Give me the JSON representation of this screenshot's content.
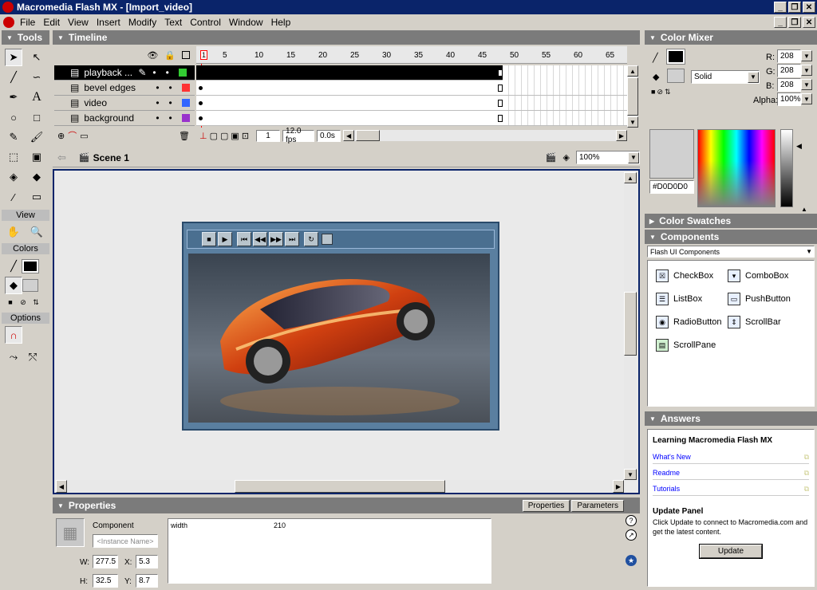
{
  "window": {
    "title": "Macromedia Flash MX - [Import_video]"
  },
  "menu": [
    "File",
    "Edit",
    "View",
    "Insert",
    "Modify",
    "Text",
    "Control",
    "Window",
    "Help"
  ],
  "tools": {
    "title": "Tools",
    "view_label": "View",
    "colors_label": "Colors",
    "options_label": "Options"
  },
  "timeline": {
    "title": "Timeline",
    "frame_numbers": [
      "1",
      "5",
      "10",
      "15",
      "20",
      "25",
      "30",
      "35",
      "40",
      "45",
      "50",
      "55",
      "60",
      "65"
    ],
    "layers": [
      {
        "name": "playback ...",
        "color": "#33cc33"
      },
      {
        "name": "bevel edges",
        "color": "#ff3333"
      },
      {
        "name": "video",
        "color": "#3366ff"
      },
      {
        "name": "background",
        "color": "#9933cc"
      }
    ],
    "current_frame": "1",
    "fps": "12.0 fps",
    "time": "0.0s"
  },
  "scene": {
    "name": "Scene 1",
    "zoom": "100%"
  },
  "color_mixer": {
    "title": "Color Mixer",
    "fill_type": "Solid",
    "r": "208",
    "g": "208",
    "b": "208",
    "alpha": "100%",
    "r_label": "R:",
    "g_label": "G:",
    "b_label": "B:",
    "alpha_label": "Alpha:",
    "hex": "#D0D0D0"
  },
  "swatches": {
    "title": "Color Swatches"
  },
  "components": {
    "title": "Components",
    "set": "Flash UI Components",
    "items": [
      "CheckBox",
      "ComboBox",
      "ListBox",
      "PushButton",
      "RadioButton",
      "ScrollBar",
      "ScrollPane"
    ]
  },
  "answers": {
    "title": "Answers",
    "heading": "Learning Macromedia Flash MX",
    "links": [
      "What's New",
      "Readme",
      "Tutorials"
    ],
    "update_title": "Update Panel",
    "update_text": "Click Update to connect to Macromedia.com and get the latest content.",
    "update_button": "Update"
  },
  "properties": {
    "title": "Properties",
    "tab_properties": "Properties",
    "tab_parameters": "Parameters",
    "type": "Component",
    "instance_placeholder": "<Instance Name>",
    "w_label": "W:",
    "w": "277.5",
    "x_label": "X:",
    "x": "5.3",
    "h_label": "H:",
    "h": "32.5",
    "y_label": "Y:",
    "y": "8.7",
    "param_name": "width",
    "param_value": "210"
  }
}
